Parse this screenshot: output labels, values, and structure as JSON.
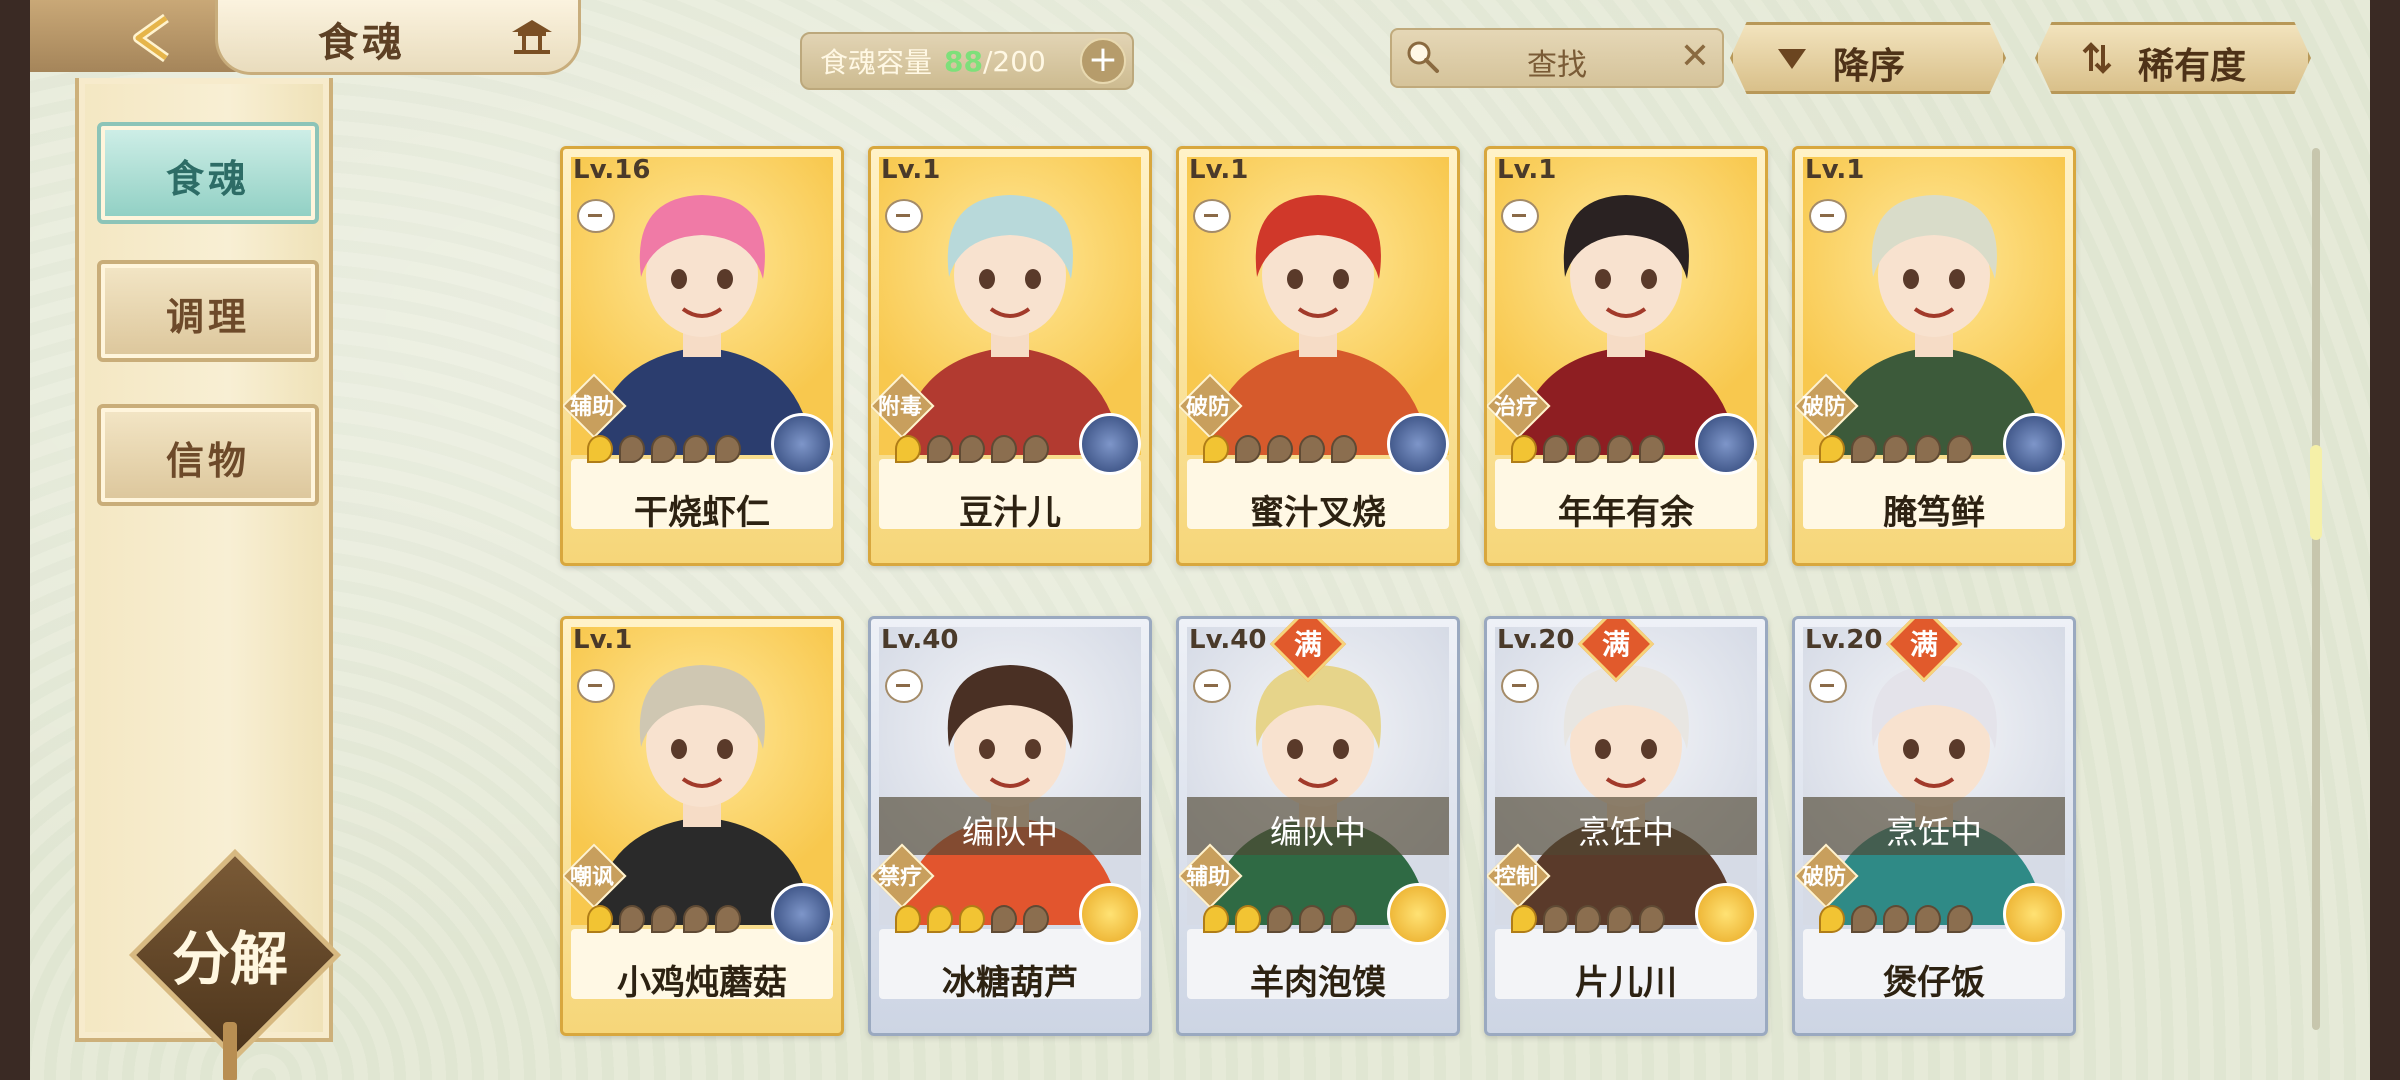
{
  "header": {
    "title": "食魂",
    "capacity_label": "食魂容量",
    "capacity_current": "88",
    "capacity_separator": "/",
    "capacity_max": "200",
    "capacity_add": "+",
    "search_placeholder": "查找",
    "search_clear": "✕",
    "sort_order_label": "降序",
    "sort_field_label": "稀有度"
  },
  "sidebar": {
    "tabs": [
      {
        "label": "食魂",
        "active": true
      },
      {
        "label": "调理",
        "active": false
      },
      {
        "label": "信物",
        "active": false
      }
    ],
    "split_label": "分解"
  },
  "cards": [
    {
      "level": "Lv.16",
      "name": "干烧虾仁",
      "role": "辅助",
      "stars_on": 1,
      "element": "blue",
      "frame": "gold",
      "status": "",
      "full": false,
      "hair": "#f07aa6",
      "outfit": "#2b3d6e"
    },
    {
      "level": "Lv.1",
      "name": "豆汁儿",
      "role": "附毒",
      "stars_on": 1,
      "element": "blue",
      "frame": "gold",
      "status": "",
      "full": false,
      "hair": "#b8d9da",
      "outfit": "#b23a30"
    },
    {
      "level": "Lv.1",
      "name": "蜜汁叉烧",
      "role": "破防",
      "stars_on": 1,
      "element": "blue",
      "frame": "gold",
      "status": "",
      "full": false,
      "hair": "#d0382a",
      "outfit": "#d65a2c"
    },
    {
      "level": "Lv.1",
      "name": "年年有余",
      "role": "治疗",
      "stars_on": 1,
      "element": "blue",
      "frame": "gold",
      "status": "",
      "full": false,
      "hair": "#2a2222",
      "outfit": "#8e1e22"
    },
    {
      "level": "Lv.1",
      "name": "腌笃鲜",
      "role": "破防",
      "stars_on": 1,
      "element": "blue",
      "frame": "gold",
      "status": "",
      "full": false,
      "hair": "#d9dcc9",
      "outfit": "#3c5a3a"
    },
    {
      "level": "Lv.1",
      "name": "小鸡炖蘑菇",
      "role": "嘲讽",
      "stars_on": 1,
      "element": "blue",
      "frame": "gold",
      "status": "",
      "full": false,
      "hair": "#cfc7b2",
      "outfit": "#2a2a2a"
    },
    {
      "level": "Lv.40",
      "name": "冰糖葫芦",
      "role": "禁疗",
      "stars_on": 3,
      "element": "gold",
      "frame": "silver",
      "status": "编队中",
      "full": false,
      "hair": "#4a3024",
      "outfit": "#e2552e"
    },
    {
      "level": "Lv.40",
      "name": "羊肉泡馍",
      "role": "辅助",
      "stars_on": 2,
      "element": "gold",
      "frame": "silver",
      "status": "编队中",
      "full": true,
      "hair": "#e6d48a",
      "outfit": "#2f6a44"
    },
    {
      "level": "Lv.20",
      "name": "片儿川",
      "role": "控制",
      "stars_on": 1,
      "element": "gold",
      "frame": "silver",
      "status": "烹饪中",
      "full": true,
      "hair": "#e8e6e2",
      "outfit": "#5a3a2a"
    },
    {
      "level": "Lv.20",
      "name": "煲仔饭",
      "role": "破防",
      "stars_on": 1,
      "element": "gold",
      "frame": "silver",
      "status": "烹饪中",
      "full": true,
      "hair": "#e4e3ea",
      "outfit": "#2f8a86"
    }
  ],
  "full_badge": "满",
  "colors": {
    "accent_teal": "#8fcfc3",
    "gold_frame": "#d8a73e",
    "silver_frame": "#9aa9c0",
    "capacity_green": "#7ee07a"
  }
}
